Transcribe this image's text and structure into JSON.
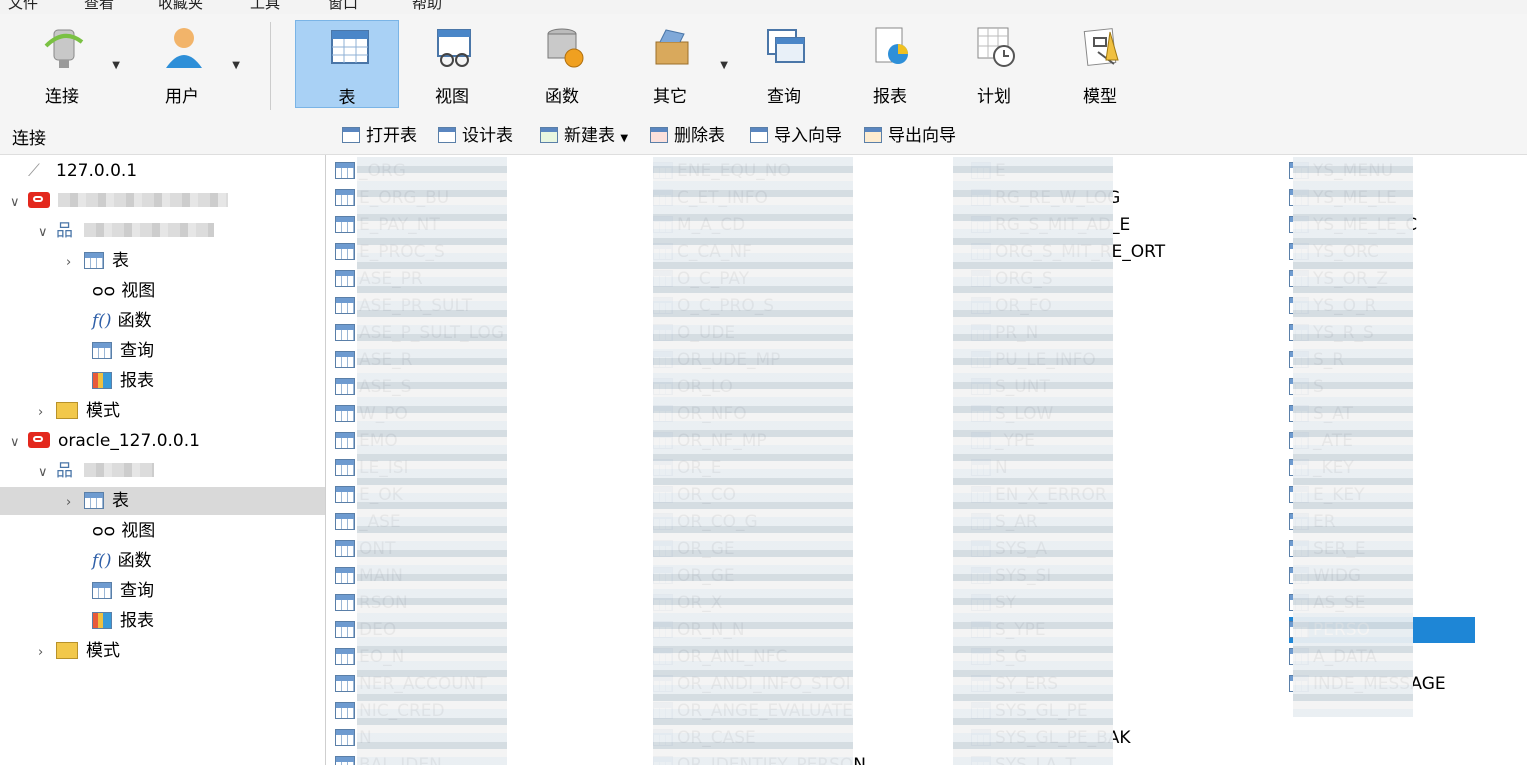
{
  "menubar": [
    "文件",
    "查看",
    "收藏夹",
    "工具",
    "窗口",
    "帮助"
  ],
  "toolbar": {
    "connect": "连接",
    "user": "用户",
    "table": "表",
    "view": "视图",
    "function": "函数",
    "other": "其它",
    "query": "查询",
    "report": "报表",
    "schedule": "计划",
    "model": "模型",
    "active_item": "表"
  },
  "subbar": {
    "connection_label": "连接",
    "open_table": "打开表",
    "design_table": "设计表",
    "new_table": "新建表",
    "delete_table": "删除表",
    "import_wizard": "导入向导",
    "export_wizard": "导出向导"
  },
  "tree": {
    "conn1": "127.0.0.1",
    "conn2_label": "oracle_127.0.0.1",
    "table": "表",
    "view": "视图",
    "function": "函数",
    "query": "查询",
    "report": "报表",
    "schema": "模式"
  },
  "tables": {
    "col1": [
      "_ORG",
      "E_ORG_BU",
      "E_PAY_NT",
      "E_PROC_S",
      "ASE_PR",
      "ASE_PR_SULT",
      "ASE_P_SULT_LOG",
      "ASE_R",
      "ASE_S",
      "W_PO",
      "EMO",
      "LE_ISI",
      "E_OK",
      "_ASE",
      "ONT",
      "MAIN",
      "RSON",
      "DEO",
      "EO_N",
      "NER_ACCOUNT",
      "NIC_CRED",
      "N",
      "BAL_IDEN"
    ],
    "col2": [
      "ENE_EQU_NO",
      "C_ET_INFO",
      "M_A_CD",
      "C_CA_NF",
      "O_C_PAY",
      "O_C_PRO_S",
      "O_UDE",
      "OR_UDE_MP",
      "OR_LO",
      "OR_NFO",
      "OR_NF_MP",
      "OR_E",
      "OR_CO",
      "OR_CO_G",
      "OR_GE",
      "OR_GE",
      "OR_X",
      "OR_N_N",
      "OR_ANL_NFC",
      "OR_ANDI_INFO_STOI",
      "OR_ANGE_EVALUATE",
      "OR_CASE",
      "OR_IDENTIFY_PERSON"
    ],
    "col3": [
      "E",
      "RG_RE_W_LOG",
      "RG_S_MIT_AD_E",
      "ORG_S_MIT_RE_ORT",
      "ORG_S",
      "OR_FO",
      "PR_N",
      "PU_LE_INFO",
      "S_UNT",
      "S_LOW",
      "_YPE",
      "N",
      "EN_X_ERROR",
      "S_AR",
      "SYS_A",
      "SYS_SI",
      "SY",
      "S_YPE",
      "S_G",
      "SY_ERS",
      "SYS_GL_PE",
      "SYS_GL_PE_BAK",
      "SYS_LA_T"
    ],
    "col4": [
      "YS_MENU",
      "YS_ME_LE",
      "YS_ME_LE_C",
      "YS_ORC",
      "YS_OR_Z",
      "YS_O_R",
      "YS_R_S",
      "S_R",
      "S",
      "S_AT",
      "_ATE",
      "_KEY",
      "E_KEY",
      "ER",
      "SER_E",
      "WIDG",
      "AS_SE",
      "PERSO",
      "A_DATA",
      "INDE_MESSAGE"
    ],
    "selected": "PERSO"
  }
}
